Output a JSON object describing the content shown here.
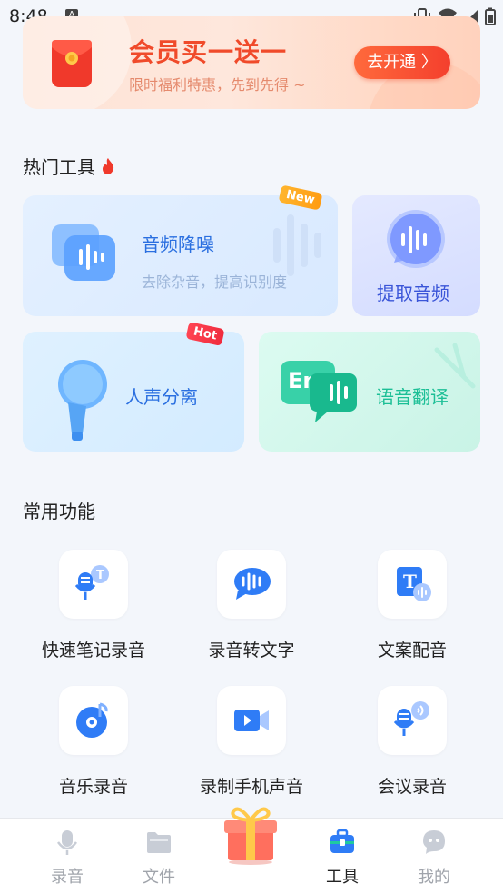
{
  "status_bar": {
    "time": "8:48",
    "notif_icon": "A"
  },
  "banner": {
    "title": "会员买一送一",
    "subtitle": "限时福利特惠，先到先得 ~",
    "button_label": "去开通 〉"
  },
  "hot_tools": {
    "title": "热门工具",
    "denoise": {
      "label": "音频降噪",
      "subtitle": "去除杂音，提高识别度",
      "badge": "New"
    },
    "extract": {
      "label": "提取音频"
    },
    "separate": {
      "label": "人声分离",
      "badge": "Hot"
    },
    "translate": {
      "label": "语音翻译",
      "icon_text": "En"
    }
  },
  "common": {
    "title": "常用功能",
    "items": [
      {
        "label": "快速笔记录音"
      },
      {
        "label": "录音转文字"
      },
      {
        "label": "文案配音",
        "icon_text": "T"
      },
      {
        "label": "音乐录音"
      },
      {
        "label": "录制手机声音"
      },
      {
        "label": "会议录音"
      }
    ]
  },
  "nav": {
    "items": [
      {
        "label": "录音"
      },
      {
        "label": "文件"
      },
      {
        "label": "工具"
      },
      {
        "label": "我的"
      }
    ],
    "active": "工具"
  },
  "colors": {
    "accent_blue": "#3a7bf0",
    "banner_red": "#f04a2a",
    "translate_green": "#1cbf96"
  }
}
